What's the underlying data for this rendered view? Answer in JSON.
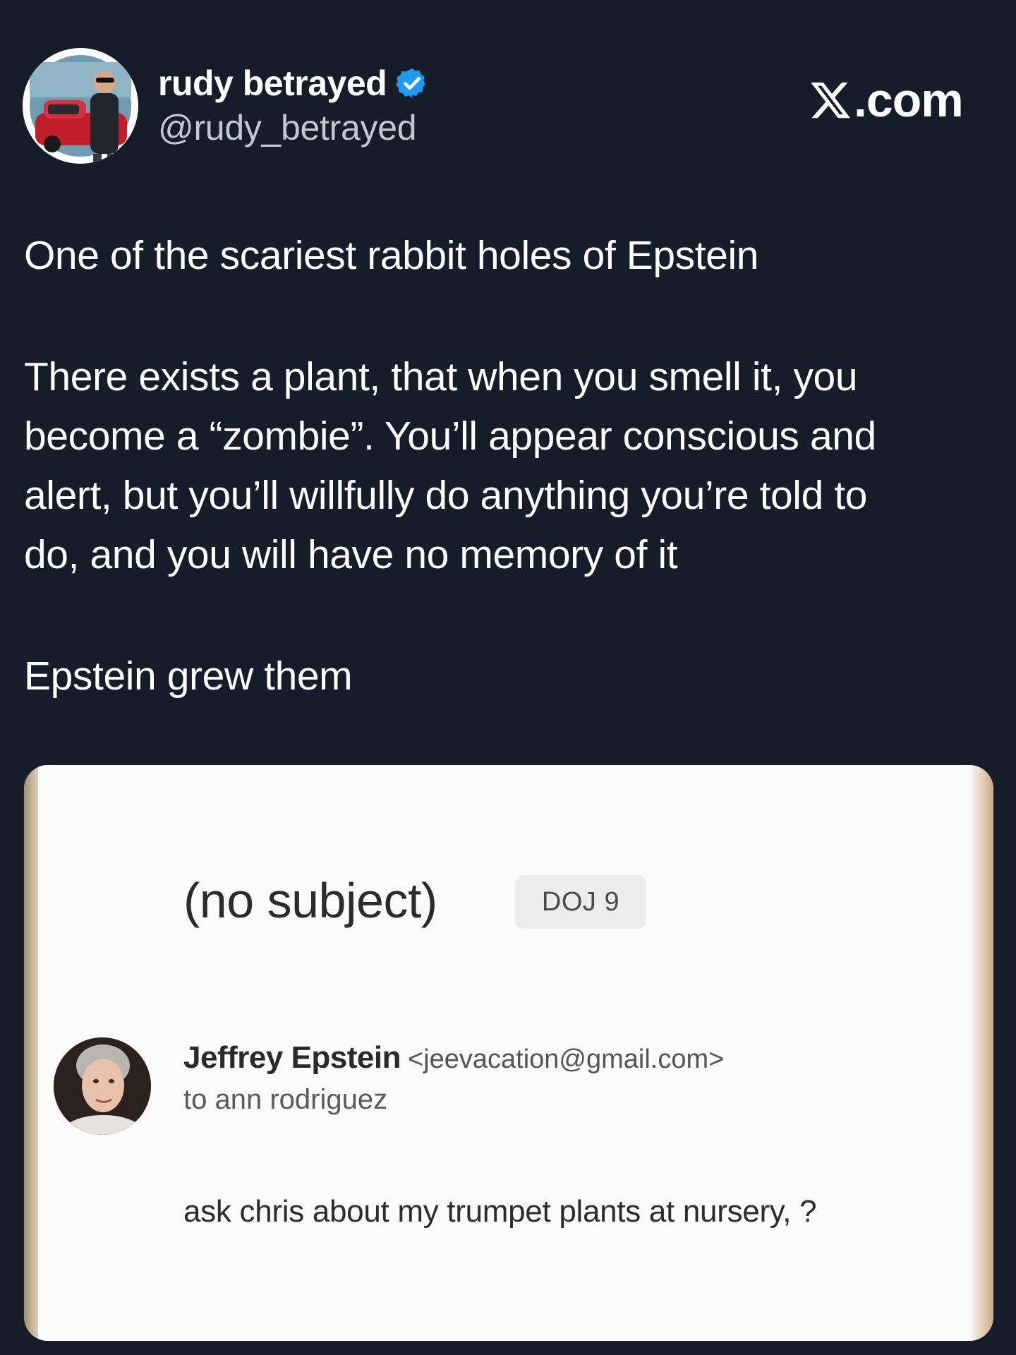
{
  "author": {
    "display_name": "rudy betrayed",
    "handle": "@rudy_betrayed",
    "verified": true,
    "avatar": "profile-photo-man-with-red-car",
    "verified_color": "#1d9bf0"
  },
  "brand": {
    "logo_icon": "x-logo-icon",
    "domain_suffix": ".com"
  },
  "tweet": {
    "paragraph_1": "One of the scariest rabbit holes of Epstein",
    "paragraph_2_lines": [
      "There exists a plant, that when you smell it, you",
      "become a “zombie”. You’ll appear conscious and",
      "alert, but you’ll willfully do anything you’re told to",
      "do, and you will have no memory of it"
    ],
    "paragraph_3": "Epstein grew them"
  },
  "embedded_email": {
    "subject": "(no subject)",
    "label": "DOJ 9",
    "sender_name": "Jeffrey Epstein",
    "sender_email": "<jeevacation@gmail.com>",
    "recipient_line": "to ann rodriguez",
    "body": "ask chris about my trumpet plants at nursery, ?",
    "sender_avatar": "profile-photo-gray-haired-man"
  },
  "colors": {
    "background": "#151d2a",
    "text": "#ffffff",
    "secondary_text": "#c4c9d0"
  }
}
